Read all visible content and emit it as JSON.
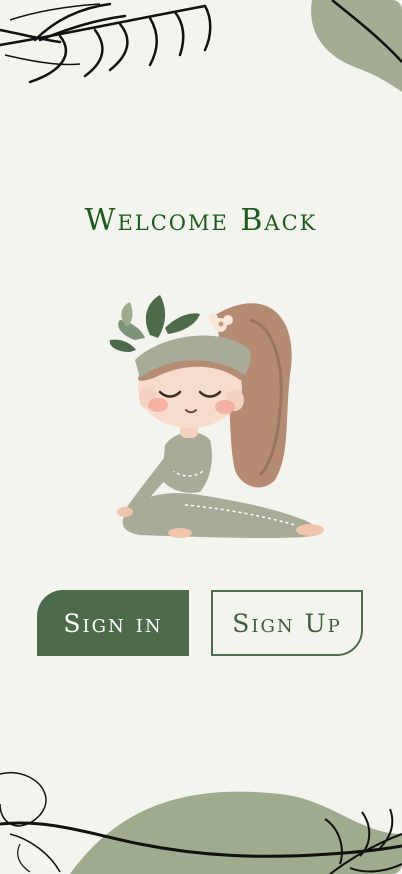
{
  "screen": {
    "title": "Welcome Back"
  },
  "buttons": {
    "sign_in_label": "Sign in",
    "sign_up_label": "Sign Up"
  },
  "illustration": {
    "subject": "girl-yoga-pose"
  },
  "colors": {
    "background": "#f4f4ef",
    "title": "#1e5a1e",
    "primary": "#4d6b4b",
    "sage": "#9eab8c"
  }
}
